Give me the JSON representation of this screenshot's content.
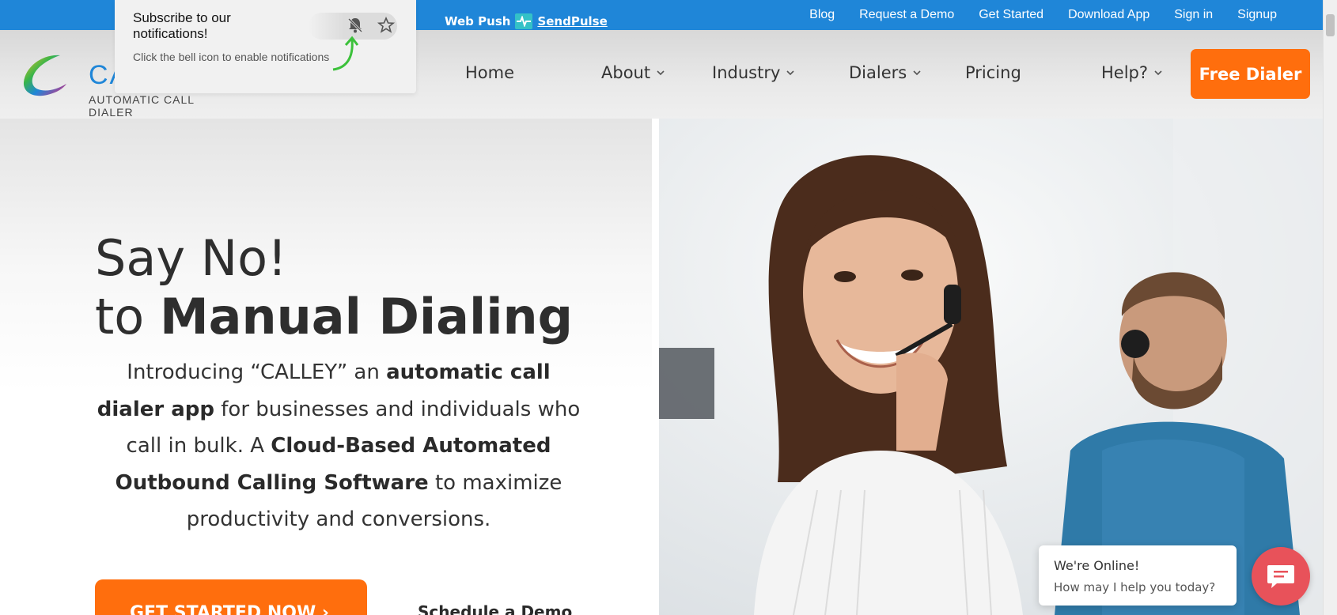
{
  "topbar": {
    "webpush": {
      "prefix": "Web Push",
      "brand": "SendPulse"
    },
    "links": [
      "Blog",
      "Request a Demo",
      "Get Started",
      "Download App",
      "Sign in",
      "Signup"
    ]
  },
  "notification": {
    "title": "Subscribe to our notifications!",
    "subtitle": "Click the bell icon to enable notifications"
  },
  "logo": {
    "name": "CALLEY",
    "tagline": "AUTOMATIC CALL DIALER"
  },
  "nav": {
    "home": "Home",
    "about": "About",
    "industry": "Industry",
    "dialers": "Dialers",
    "pricing": "Pricing",
    "help": "Help?",
    "free_dialer": "Free Dialer"
  },
  "hero": {
    "line1": "Say No!",
    "line2_prefix": "to ",
    "line2_bold": "Manual Dialing",
    "intro": {
      "p1": "Introducing “CALLEY” an ",
      "b1": "automatic call dialer app",
      "p2": " for businesses and individuals who call in bulk. A ",
      "b2": "Cloud-Based Automated Outbound Calling Software",
      "p3": " to maximize productivity and conversions."
    },
    "cta": "GET STARTED NOW  ›",
    "demo": "Schedule a Demo"
  },
  "chat": {
    "title": "We're Online!",
    "subtitle": "How may I help you today?"
  },
  "colors": {
    "topbar": "#1f86d8",
    "accent_orange": "#ff6e0d",
    "chat_red": "#e8525a",
    "sendpulse": "#34c1c7"
  }
}
